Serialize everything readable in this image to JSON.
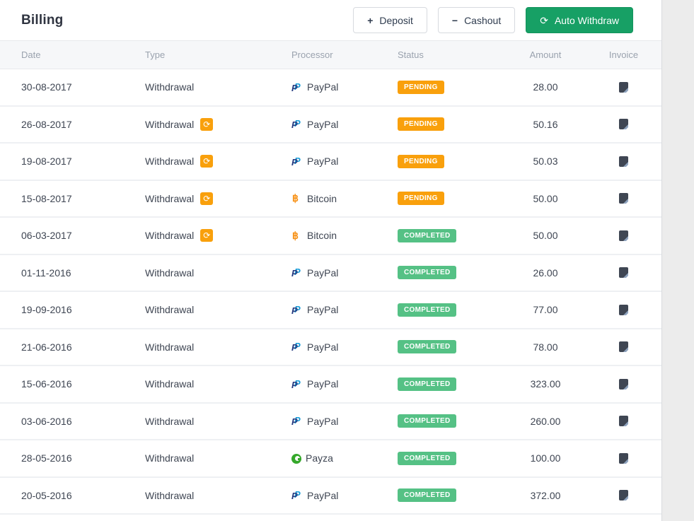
{
  "page": {
    "title": "Billing"
  },
  "toolbar": {
    "deposit": {
      "label": "Deposit",
      "icon": "+"
    },
    "cashout": {
      "label": "Cashout",
      "icon": "−"
    },
    "auto_withdraw": {
      "label": "Auto Withdraw",
      "icon": "⟳"
    }
  },
  "icons": {
    "refresh": "⟳"
  },
  "table": {
    "columns": {
      "date": "Date",
      "type": "Type",
      "processor": "Processor",
      "status": "Status",
      "amount": "Amount",
      "invoice": "Invoice"
    },
    "rows": [
      {
        "date": "30-08-2017",
        "type": "Withdrawal",
        "auto": false,
        "processor": "PayPal",
        "status": "PENDING",
        "amount": "28.00"
      },
      {
        "date": "26-08-2017",
        "type": "Withdrawal",
        "auto": true,
        "processor": "PayPal",
        "status": "PENDING",
        "amount": "50.16"
      },
      {
        "date": "19-08-2017",
        "type": "Withdrawal",
        "auto": true,
        "processor": "PayPal",
        "status": "PENDING",
        "amount": "50.03"
      },
      {
        "date": "15-08-2017",
        "type": "Withdrawal",
        "auto": true,
        "processor": "Bitcoin",
        "status": "PENDING",
        "amount": "50.00"
      },
      {
        "date": "06-03-2017",
        "type": "Withdrawal",
        "auto": true,
        "processor": "Bitcoin",
        "status": "COMPLETED",
        "amount": "50.00"
      },
      {
        "date": "01-11-2016",
        "type": "Withdrawal",
        "auto": false,
        "processor": "PayPal",
        "status": "COMPLETED",
        "amount": "26.00"
      },
      {
        "date": "19-09-2016",
        "type": "Withdrawal",
        "auto": false,
        "processor": "PayPal",
        "status": "COMPLETED",
        "amount": "77.00"
      },
      {
        "date": "21-06-2016",
        "type": "Withdrawal",
        "auto": false,
        "processor": "PayPal",
        "status": "COMPLETED",
        "amount": "78.00"
      },
      {
        "date": "15-06-2016",
        "type": "Withdrawal",
        "auto": false,
        "processor": "PayPal",
        "status": "COMPLETED",
        "amount": "323.00"
      },
      {
        "date": "03-06-2016",
        "type": "Withdrawal",
        "auto": false,
        "processor": "PayPal",
        "status": "COMPLETED",
        "amount": "260.00"
      },
      {
        "date": "28-05-2016",
        "type": "Withdrawal",
        "auto": false,
        "processor": "Payza",
        "status": "COMPLETED",
        "amount": "100.00"
      },
      {
        "date": "20-05-2016",
        "type": "Withdrawal",
        "auto": false,
        "processor": "PayPal",
        "status": "COMPLETED",
        "amount": "372.00"
      }
    ]
  },
  "colors": {
    "pending": "#F9A00C",
    "completed": "#55C185",
    "refresh_badge": "#F9A00C",
    "button_green": "#17A065",
    "paypal_dark": "#253B80",
    "paypal_light": "#179BD7",
    "bitcoin": "#F7931A",
    "payza": "#35A82B",
    "invoice_icon": "#3F4653"
  }
}
